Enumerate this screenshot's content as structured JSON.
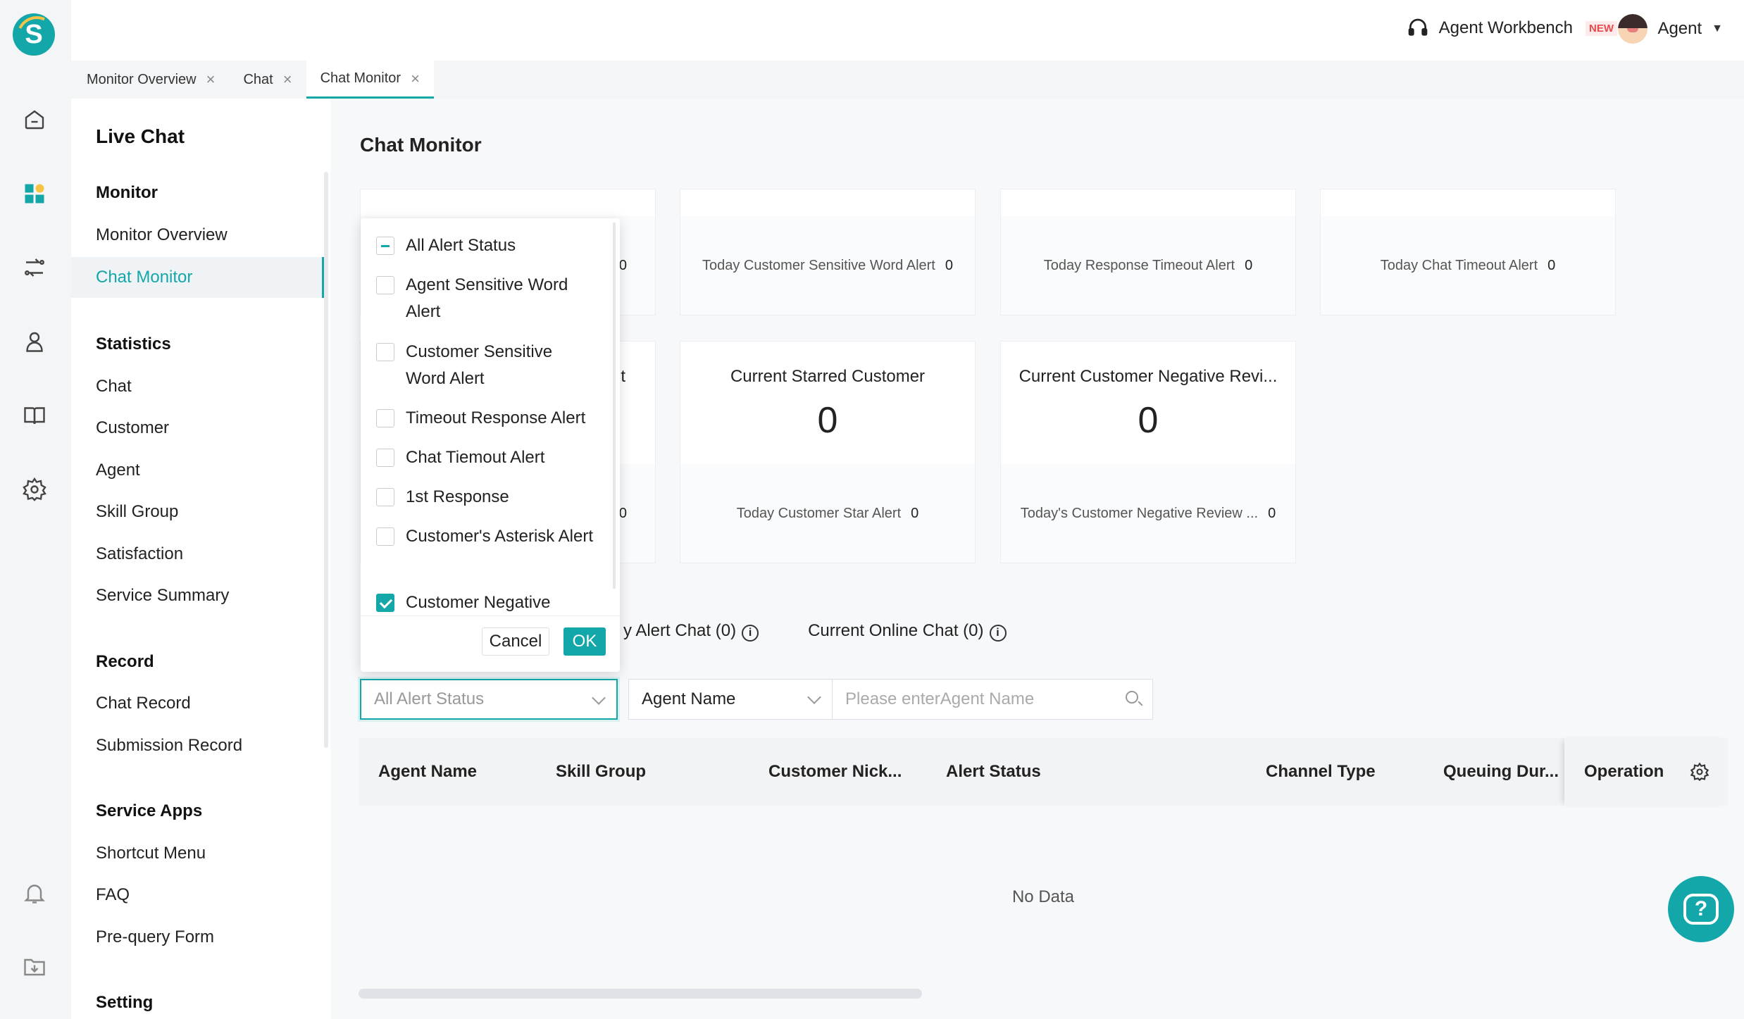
{
  "header": {
    "workbench_label": "Agent Workbench",
    "new_badge": "NEW",
    "user_name": "Agent"
  },
  "tabs": [
    {
      "label": "Monitor Overview"
    },
    {
      "label": "Chat"
    },
    {
      "label": "Chat Monitor"
    }
  ],
  "sidebar": {
    "title": "Live Chat",
    "monitor_group": "Monitor",
    "monitor_overview": "Monitor Overview",
    "chat_monitor": "Chat Monitor",
    "statistics_group": "Statistics",
    "chat": "Chat",
    "customer": "Customer",
    "agent": "Agent",
    "skill_group": "Skill Group",
    "satisfaction": "Satisfaction",
    "service_summary": "Service Summary",
    "record_group": "Record",
    "chat_record": "Chat Record",
    "submission_record": "Submission Record",
    "service_apps_group": "Service Apps",
    "shortcut_menu": "Shortcut Menu",
    "faq": "FAQ",
    "pre_query_form": "Pre-query Form",
    "setting_group": "Setting"
  },
  "page": {
    "title": "Chat Monitor"
  },
  "cards": {
    "row1": [
      {
        "bottom_value": "0"
      },
      {
        "bottom_label": "Today Customer Sensitive Word Alert",
        "bottom_value": "0"
      },
      {
        "bottom_label": "Today Response Timeout Alert",
        "bottom_value": "0"
      },
      {
        "bottom_label": "Today Chat Timeout Alert",
        "bottom_value": "0"
      }
    ],
    "row2": [
      {
        "top_label_tail": "t",
        "bottom_value": "0"
      },
      {
        "top_label": "Current Starred Customer",
        "value": "0",
        "bottom_label": "Today Customer Star Alert",
        "bottom_value": "0"
      },
      {
        "top_label": "Current Customer Negative Revi...",
        "value": "0",
        "bottom_label": "Today's Customer Negative Review ...",
        "bottom_value": "0"
      }
    ]
  },
  "lists": {
    "alert_chat": "y Alert Chat (0)",
    "online_chat": "Current Online Chat (0)",
    "info_glyph": "i"
  },
  "filters": {
    "alert_status_placeholder": "All Alert Status",
    "agent_select": "Agent Name",
    "agent_input_placeholder": "Please enterAgent Name"
  },
  "table": {
    "columns": [
      "Agent Name",
      "Skill Group",
      "Customer Nick...",
      "Alert Status",
      "Channel Type",
      "Queuing Dur...",
      "Operation"
    ],
    "empty_text": "No Data"
  },
  "dropdown": {
    "options": [
      {
        "label": "All Alert Status",
        "state": "indeterminate"
      },
      {
        "label": "Agent Sensitive Word Alert",
        "state": "unchecked"
      },
      {
        "label": "Customer Sensitive Word Alert",
        "state": "unchecked"
      },
      {
        "label": "Timeout Response Alert",
        "state": "unchecked"
      },
      {
        "label": "Chat Tiemout Alert",
        "state": "unchecked"
      },
      {
        "label": "1st Response",
        "state": "unchecked"
      },
      {
        "label": "Customer's Asterisk Alert",
        "state": "unchecked"
      },
      {
        "label": "Customer Negative",
        "state": "checked"
      }
    ],
    "cancel_label": "Cancel",
    "ok_label": "OK"
  },
  "help": {
    "glyph": "?"
  },
  "colors": {
    "accent": "#14a7a9",
    "new_badge": "#e94b4b"
  }
}
